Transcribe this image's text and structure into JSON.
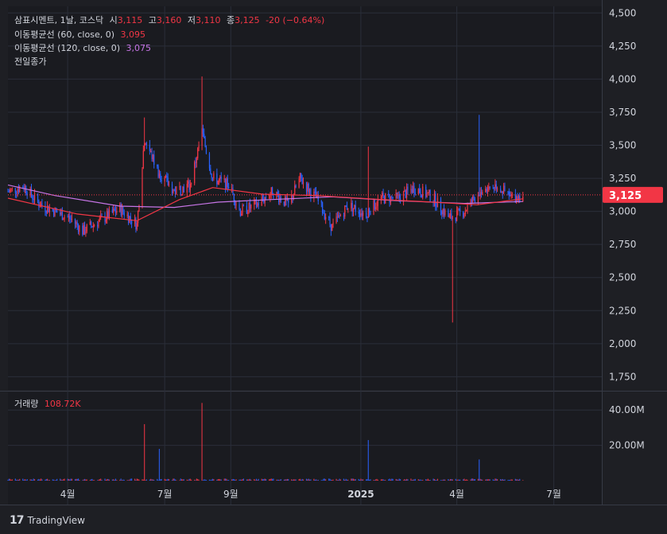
{
  "legend": {
    "symbol": "삼표시멘트, 1날, 코스닥",
    "o_label": "시",
    "o": "3,115",
    "h_label": "고",
    "h": "3,160",
    "l_label": "저",
    "l": "3,110",
    "c_label": "종",
    "c": "3,125",
    "change": "-20 (−0.64%)",
    "ma60_label": "이동평균선 (60, close, 0)",
    "ma60_value": "3,095",
    "ma120_label": "이동평균선 (120, close, 0)",
    "ma120_value": "3,075",
    "prev_close_label": "전일종가",
    "volume_label": "거래량",
    "volume_value": "108.72K"
  },
  "price_badge": "3,125",
  "brand": "TradingView",
  "colors": {
    "up": "#f23645",
    "down": "#2962ff",
    "ma60": "#f23645",
    "ma120": "#c775e6",
    "bg": "#1e1f24",
    "grid": "#2a2e39"
  },
  "chart_data": {
    "type": "candlestick",
    "title": "삼표시멘트",
    "price_axis_ticks": [
      "4,500",
      "4,250",
      "4,000",
      "3,750",
      "3,500",
      "3,250",
      "3,000",
      "2,750",
      "2,500",
      "2,250",
      "2,000",
      "1,750"
    ],
    "price_tick_values": [
      4500,
      4250,
      4000,
      3750,
      3500,
      3250,
      3000,
      2750,
      2500,
      2250,
      2000,
      1750
    ],
    "ylim": [
      1650,
      4550
    ],
    "volume_axis_ticks": [
      "40.00M",
      "20.00M"
    ],
    "volume_tick_values": [
      40000000,
      20000000
    ],
    "volume_ylim": [
      0,
      50000000
    ],
    "time_axis_ticks": [
      "4월",
      "7월",
      "9월",
      "2025",
      "4월",
      "7월"
    ],
    "last_close": 3125,
    "close_path": [
      {
        "t": "2024-02-05",
        "close": 3150
      },
      {
        "t": "2024-02-20",
        "close": 3190
      },
      {
        "t": "2024-03-05",
        "close": 3060
      },
      {
        "t": "2024-03-20",
        "close": 3000
      },
      {
        "t": "2024-04-05",
        "close": 2940
      },
      {
        "t": "2024-04-15",
        "close": 2850
      },
      {
        "t": "2024-05-01",
        "close": 2930
      },
      {
        "t": "2024-05-20",
        "close": 3020
      },
      {
        "t": "2024-06-05",
        "close": 2900
      },
      {
        "t": "2024-06-12",
        "close": 3550
      },
      {
        "t": "2024-06-25",
        "close": 3300
      },
      {
        "t": "2024-07-10",
        "close": 3150
      },
      {
        "t": "2024-07-25",
        "close": 3200
      },
      {
        "t": "2024-08-05",
        "close": 3600
      },
      {
        "t": "2024-08-15",
        "close": 3250
      },
      {
        "t": "2024-08-30",
        "close": 3200
      },
      {
        "t": "2024-09-10",
        "close": 3000
      },
      {
        "t": "2024-09-25",
        "close": 3050
      },
      {
        "t": "2024-10-10",
        "close": 3150
      },
      {
        "t": "2024-10-25",
        "close": 3050
      },
      {
        "t": "2024-11-05",
        "close": 3250
      },
      {
        "t": "2024-11-20",
        "close": 3100
      },
      {
        "t": "2024-12-05",
        "close": 2880
      },
      {
        "t": "2024-12-20",
        "close": 3050
      },
      {
        "t": "2025-01-05",
        "close": 2980
      },
      {
        "t": "2025-01-20",
        "close": 3100
      },
      {
        "t": "2025-02-05",
        "close": 3100
      },
      {
        "t": "2025-02-20",
        "close": 3180
      },
      {
        "t": "2025-03-10",
        "close": 3100
      },
      {
        "t": "2025-03-25",
        "close": 2950
      },
      {
        "t": "2025-04-08",
        "close": 3000
      },
      {
        "t": "2025-04-22",
        "close": 3150
      },
      {
        "t": "2025-05-08",
        "close": 3200
      },
      {
        "t": "2025-05-22",
        "close": 3100
      },
      {
        "t": "2025-06-02",
        "close": 3125
      }
    ],
    "notable_wicks": [
      {
        "t": "2024-06-12",
        "high": 3710
      },
      {
        "t": "2024-08-05",
        "high": 4020
      },
      {
        "t": "2025-01-08",
        "high": 3490
      },
      {
        "t": "2025-03-28",
        "low": 2160
      },
      {
        "t": "2025-04-22",
        "high": 3730
      }
    ],
    "ma60_path": [
      {
        "t": "2024-02-05",
        "v": 3100
      },
      {
        "t": "2024-04-10",
        "v": 2980
      },
      {
        "t": "2024-06-05",
        "v": 2930
      },
      {
        "t": "2024-07-15",
        "v": 3090
      },
      {
        "t": "2024-08-15",
        "v": 3180
      },
      {
        "t": "2024-10-01",
        "v": 3130
      },
      {
        "t": "2024-11-20",
        "v": 3120
      },
      {
        "t": "2025-01-20",
        "v": 3090
      },
      {
        "t": "2025-03-10",
        "v": 3070
      },
      {
        "t": "2025-04-20",
        "v": 3050
      },
      {
        "t": "2025-06-02",
        "v": 3095
      }
    ],
    "ma120_path": [
      {
        "t": "2024-02-05",
        "v": 3200
      },
      {
        "t": "2024-03-20",
        "v": 3120
      },
      {
        "t": "2024-05-20",
        "v": 3040
      },
      {
        "t": "2024-07-10",
        "v": 3030
      },
      {
        "t": "2024-08-20",
        "v": 3070
      },
      {
        "t": "2024-10-10",
        "v": 3090
      },
      {
        "t": "2024-12-05",
        "v": 3110
      },
      {
        "t": "2025-02-05",
        "v": 3080
      },
      {
        "t": "2025-04-08",
        "v": 3060
      },
      {
        "t": "2025-06-02",
        "v": 3075
      }
    ],
    "volume_spikes": [
      {
        "t": "2024-06-12",
        "v": 32000000,
        "dir": "up"
      },
      {
        "t": "2024-06-26",
        "v": 18000000,
        "dir": "down"
      },
      {
        "t": "2024-08-05",
        "v": 44000000,
        "dir": "up"
      },
      {
        "t": "2025-01-08",
        "v": 23000000,
        "dir": "down"
      },
      {
        "t": "2025-04-22",
        "v": 12000000,
        "dir": "down"
      }
    ]
  }
}
